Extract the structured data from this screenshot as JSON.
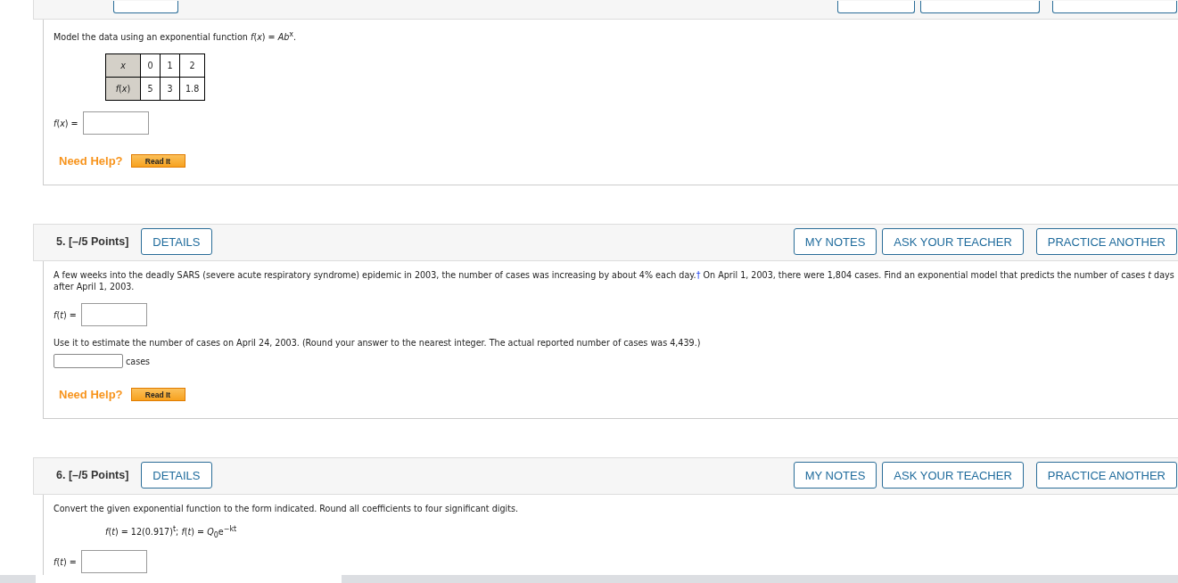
{
  "questions": [
    {
      "kind": "cut",
      "items": [
        {
          "kind": "text",
          "text": "Model the data using an exponential function *f*(*x*) = *Ab*$^{x}$."
        },
        {
          "kind": "table",
          "rows": [
            [
              "*x*",
              "0",
              "1",
              "2"
            ],
            [
              "*f*(*x*)",
              "5",
              "3",
              "1.8"
            ]
          ]
        },
        {
          "kind": "answer",
          "label": "*f*(*x*) ="
        },
        {
          "kind": "help",
          "label": "Need Help?",
          "button": "Read It"
        }
      ]
    },
    {
      "kind": "full",
      "number": "5.",
      "points": "[–/5 Points]",
      "details": "DETAILS",
      "actions": [
        "MY NOTES",
        "ASK YOUR TEACHER",
        "PRACTICE ANOTHER"
      ],
      "items": [
        {
          "kind": "footnoted",
          "before": "A few weeks into the deadly SARS (severe acute respiratory syndrome) epidemic in 2003, the number of cases was increasing by about 4% each day.",
          "mark": "†",
          "after": " On April 1, 2003, there were 1,804 cases. Find an exponential model that predicts the number of cases *t* days after April 1, 2003."
        },
        {
          "kind": "answer",
          "label": "*f*(*t*) ="
        },
        {
          "kind": "text",
          "text": "Use it to estimate the number of cases on April 24, 2003. (Round your answer to the nearest integer. The actual reported number of cases was 4,439.)"
        },
        {
          "kind": "suffix",
          "suffix": "cases"
        },
        {
          "kind": "help",
          "label": "Need Help?",
          "button": "Read It"
        }
      ]
    },
    {
      "kind": "full",
      "number": "6.",
      "points": "[–/5 Points]",
      "details": "DETAILS",
      "actions": [
        "MY NOTES",
        "ASK YOUR TEACHER",
        "PRACTICE ANOTHER"
      ],
      "items": [
        {
          "kind": "text",
          "text": "Convert the given exponential function to the form indicated. Round all coefficients to four significant digits."
        },
        {
          "kind": "formula",
          "text": "*f*(*t*) = 12(0.917)$^{t}$;  *f*(*t*) = *Q*$_{0}$e$^{−kt}$"
        },
        {
          "kind": "answer",
          "label": "*f*(*t*) ="
        }
      ]
    }
  ]
}
